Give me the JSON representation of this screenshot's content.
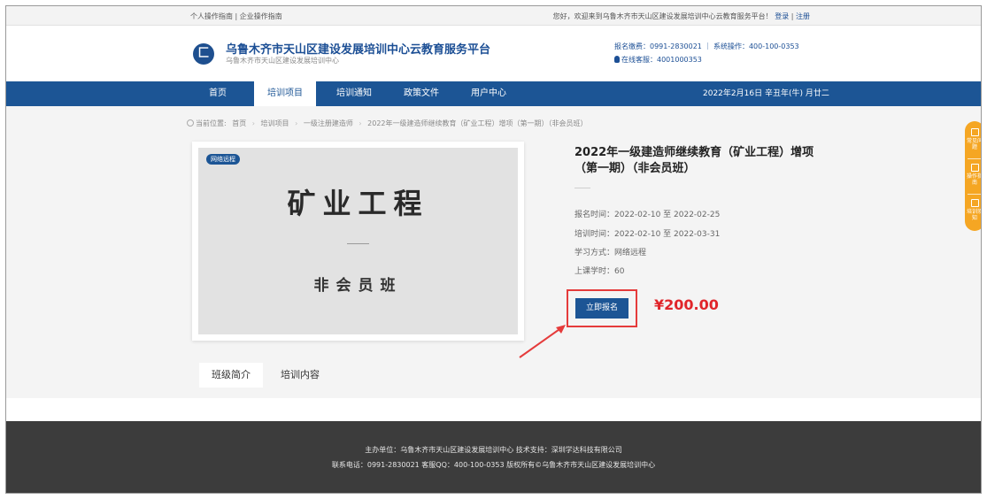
{
  "topbar": {
    "personal_guide": "个人操作指南",
    "separator": "|",
    "company_guide": "企业操作指南",
    "welcome": "您好，欢迎来到乌鲁木齐市天山区建设发展培训中心云教育服务平台！",
    "login": "登录",
    "register": "注册"
  },
  "header": {
    "logo_glyph": "匚",
    "title": "乌鲁木齐市天山区建设发展培训中心云教育服务平台",
    "subtitle": "乌鲁木齐市天山区建设发展培训中心",
    "contact_line1": "报名缴费：0991-2830021 ｜ 系统操作：400-100-0353",
    "contact_line2": "在线客服：4001000353"
  },
  "nav": {
    "items": [
      {
        "label": "首页"
      },
      {
        "label": "培训项目"
      },
      {
        "label": "培训通知"
      },
      {
        "label": "政策文件"
      },
      {
        "label": "用户中心"
      }
    ],
    "date": "2022年2月16日 辛丑年(牛) 月廿二"
  },
  "breadcrumb": {
    "prefix": "当前位置:",
    "items": [
      "首页",
      "培训项目",
      "一级注册建造师",
      "2022年一级建造师继续教育（矿业工程）增项（第一期）（非会员班）"
    ]
  },
  "course_image": {
    "tag": "网络远程",
    "main_title": "矿业工程",
    "class_name": "非会员班"
  },
  "course": {
    "title": "2022年一级建造师继续教育（矿业工程）增项（第一期）（非会员班）",
    "signup_period": "报名时间：2022-02-10 至 2022-02-25",
    "training_period": "培训时间：2022-02-10 至 2022-03-31",
    "study_mode": "学习方式：网络远程",
    "class_hours": "上课学时：60",
    "enroll_label": "立即报名",
    "price": "¥200.00"
  },
  "tabs": [
    {
      "label": "班级简介"
    },
    {
      "label": "培训内容"
    }
  ],
  "sidebar": {
    "items": [
      {
        "label": "常见问题",
        "icon": "question-icon"
      },
      {
        "label": "操作指南",
        "icon": "guide-icon"
      },
      {
        "label": "培训须知",
        "icon": "notice-icon"
      }
    ]
  },
  "footer": {
    "line1": "主办单位：乌鲁木齐市天山区建设发展培训中心 技术支持：深圳学达科技有限公司",
    "line2": "联系电话：0991-2830021 客服QQ：400-100-0353 版权所有©乌鲁木齐市天山区建设发展培训中心"
  },
  "colors": {
    "brand_blue": "#1c5595",
    "price_red": "#e0252a",
    "sidebar_orange": "#f5a623",
    "footer_gray": "#3c3c3c"
  }
}
